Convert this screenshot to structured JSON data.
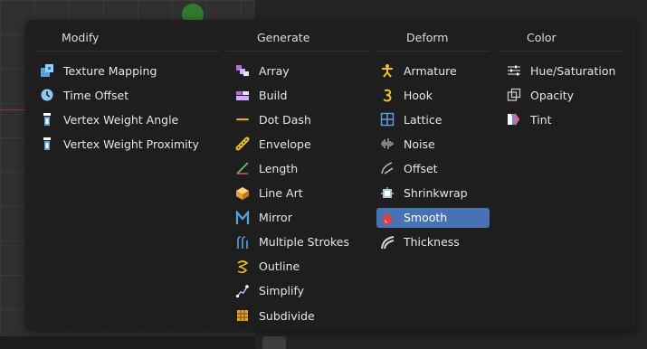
{
  "columns": [
    {
      "title": "Modify",
      "items": [
        {
          "label": "Texture Mapping",
          "icon": "texture-mapping-icon"
        },
        {
          "label": "Time Offset",
          "icon": "time-offset-icon"
        },
        {
          "label": "Vertex Weight Angle",
          "icon": "vertex-weight-icon"
        },
        {
          "label": "Vertex Weight Proximity",
          "icon": "vertex-weight-icon"
        }
      ]
    },
    {
      "title": "Generate",
      "items": [
        {
          "label": "Array",
          "icon": "array-icon"
        },
        {
          "label": "Build",
          "icon": "build-icon"
        },
        {
          "label": "Dot Dash",
          "icon": "dot-dash-icon"
        },
        {
          "label": "Envelope",
          "icon": "envelope-icon"
        },
        {
          "label": "Length",
          "icon": "length-icon"
        },
        {
          "label": "Line Art",
          "icon": "line-art-icon"
        },
        {
          "label": "Mirror",
          "icon": "mirror-icon"
        },
        {
          "label": "Multiple Strokes",
          "icon": "multiple-strokes-icon"
        },
        {
          "label": "Outline",
          "icon": "outline-icon"
        },
        {
          "label": "Simplify",
          "icon": "simplify-icon"
        },
        {
          "label": "Subdivide",
          "icon": "subdivide-icon"
        }
      ]
    },
    {
      "title": "Deform",
      "items": [
        {
          "label": "Armature",
          "icon": "armature-icon"
        },
        {
          "label": "Hook",
          "icon": "hook-icon"
        },
        {
          "label": "Lattice",
          "icon": "lattice-icon"
        },
        {
          "label": "Noise",
          "icon": "noise-icon"
        },
        {
          "label": "Offset",
          "icon": "offset-icon"
        },
        {
          "label": "Shrinkwrap",
          "icon": "shrinkwrap-icon"
        },
        {
          "label": "Smooth",
          "icon": "smooth-icon",
          "active": true
        },
        {
          "label": "Thickness",
          "icon": "thickness-icon"
        }
      ]
    },
    {
      "title": "Color",
      "items": [
        {
          "label": "Hue/Saturation",
          "icon": "hue-saturation-icon"
        },
        {
          "label": "Opacity",
          "icon": "opacity-icon"
        },
        {
          "label": "Tint",
          "icon": "tint-icon"
        }
      ]
    }
  ],
  "colors": {
    "menu_bg": "#1e1e1e",
    "highlight": "#4772b3",
    "icon_blue": "#5aa0e0",
    "icon_orange": "#e8a030",
    "icon_yellow": "#f0c020",
    "icon_purple": "#b070e0"
  }
}
